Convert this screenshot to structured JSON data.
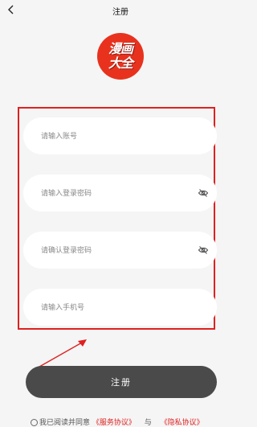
{
  "nav": {
    "title": "注册",
    "back_icon": "chevron-left-icon"
  },
  "logo": {
    "line1": "漫画",
    "line2": "大全",
    "color": "#e8321e"
  },
  "form": {
    "account_placeholder": "请输入账号",
    "password_placeholder": "请输入登录密码",
    "confirm_placeholder": "请确认登录密码",
    "phone_placeholder": "请输入手机号",
    "visibility_icon": "eye-off-icon"
  },
  "register_label": "注册",
  "agreement": {
    "prefix": "我已阅读并同意",
    "service_link": "《服务协议》",
    "connector": "与",
    "privacy_link": "《隐私协议》"
  },
  "colors": {
    "highlight": "#e02020",
    "button": "#4a4a4a",
    "background": "#f5f5f5"
  }
}
